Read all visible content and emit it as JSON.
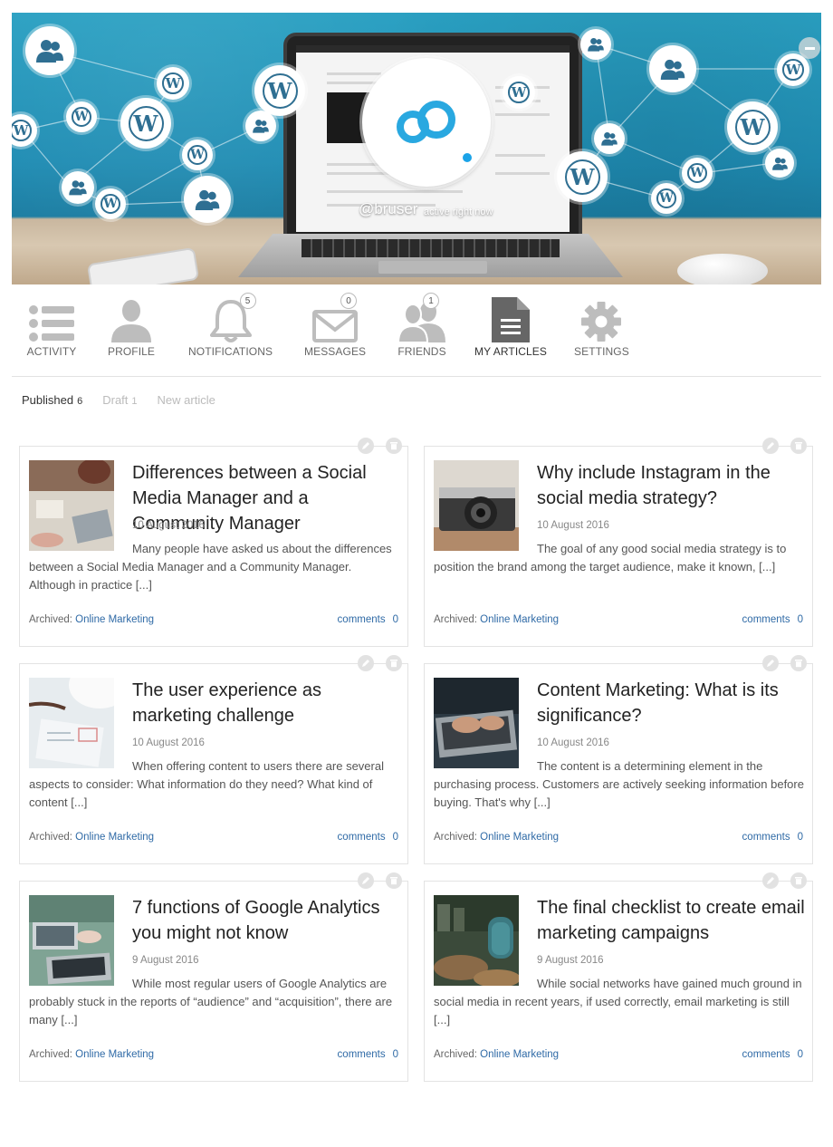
{
  "profile": {
    "username": "@bruser",
    "status": "active right now"
  },
  "nav": {
    "items": [
      {
        "label": "ACTIVITY",
        "icon": "list-icon"
      },
      {
        "label": "PROFILE",
        "icon": "user-icon"
      },
      {
        "label": "NOTIFICATIONS",
        "icon": "bell-icon",
        "badge": "5"
      },
      {
        "label": "MESSAGES",
        "icon": "envelope-icon",
        "badge": "0"
      },
      {
        "label": "FRIENDS",
        "icon": "friends-icon",
        "badge": "1"
      },
      {
        "label": "MY ARTICLES",
        "icon": "document-icon",
        "active": true
      },
      {
        "label": "SETTINGS",
        "icon": "gear-icon"
      }
    ]
  },
  "subtabs": {
    "published": {
      "label": "Published",
      "count": "6"
    },
    "draft": {
      "label": "Draft",
      "count": "1"
    },
    "new_article": {
      "label": "New article"
    }
  },
  "articles": [
    {
      "title": "Differences between a Social Media Manager and a Community Manager",
      "date": "10 August 2016",
      "excerpt": "Many people have asked us about the differences between a Social Media Manager and a Community Manager. Although in practice [...]",
      "archived_label": "Archived:",
      "category": "Online Marketing",
      "comments_label": "comments",
      "comments_count": "0"
    },
    {
      "title": "Why include Instagram in the social media strategy?",
      "date": "10 August 2016",
      "excerpt": "The goal of any good social media strategy is to position the brand among the target audience, make it known, [...]",
      "archived_label": "Archived:",
      "category": "Online Marketing",
      "comments_label": "comments",
      "comments_count": "0"
    },
    {
      "title": "The user experience as marketing challenge",
      "date": "10 August 2016",
      "excerpt": "When offering content to users there are several aspects to consider: What information do they need? What kind of content [...]",
      "archived_label": "Archived:",
      "category": "Online Marketing",
      "comments_label": "comments",
      "comments_count": "0"
    },
    {
      "title": "Content Marketing: What is its significance?",
      "date": "10 August 2016",
      "excerpt": "The content is a determining element in the purchasing process. Customers are actively seeking information before buying. That's why [...]",
      "archived_label": "Archived:",
      "category": "Online Marketing",
      "comments_label": "comments",
      "comments_count": "0"
    },
    {
      "title": "7 functions of Google Analytics you might not know",
      "date": "9 August 2016",
      "excerpt": "While most regular users of Google Analytics are probably stuck in the reports of “audience” and “acquisition”, there are many [...]",
      "archived_label": "Archived:",
      "category": "Online Marketing",
      "comments_label": "comments",
      "comments_count": "0"
    },
    {
      "title": "The final checklist to create email marketing campaigns",
      "date": "9 August 2016",
      "excerpt": "While social networks have gained much ground in social media in recent years, if used correctly, email marketing is still [...]",
      "archived_label": "Archived:",
      "category": "Online Marketing",
      "comments_label": "comments",
      "comments_count": "0"
    }
  ],
  "colors": {
    "accent_link": "#2f6aa6",
    "status_dot": "#1ba3e8",
    "logo_blue": "#29a8e0",
    "cover_blue": "#1f8cb3"
  }
}
